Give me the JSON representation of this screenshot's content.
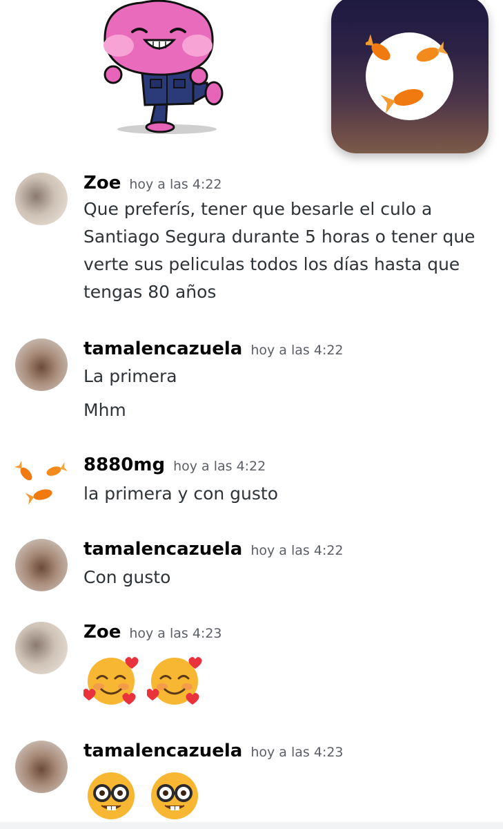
{
  "messages": [
    {
      "author": "Zoe",
      "time": "hoy a las 4:22",
      "lines": [
        "Que preferís, tener que besarle el culo a",
        "Santiago Segura durante 5 horas o tener que",
        "verte sus peliculas todos los días hasta que",
        "tengas 80 años"
      ]
    },
    {
      "author": "tamalencazuela",
      "time": "hoy a las 4:22",
      "lines": [
        "La primera",
        "Mhm"
      ]
    },
    {
      "author": "8880mg",
      "time": "hoy a las 4:22",
      "lines": [
        "la primera y con gusto"
      ]
    },
    {
      "author": "tamalencazuela",
      "time": "hoy a las 4:22",
      "lines": [
        "Con gusto"
      ]
    },
    {
      "author": "Zoe",
      "time": "hoy a las 4:23",
      "emojis": [
        "smiling-face-with-hearts",
        "smiling-face-with-hearts"
      ]
    },
    {
      "author": "tamalencazuela",
      "time": "hoy a las 4:23",
      "emojis": [
        "nerd-face",
        "nerd-face"
      ]
    }
  ],
  "colors": {
    "author": "#060607",
    "timestamp": "#5c5e66",
    "text": "#2e3338",
    "background": "#ffffff"
  }
}
